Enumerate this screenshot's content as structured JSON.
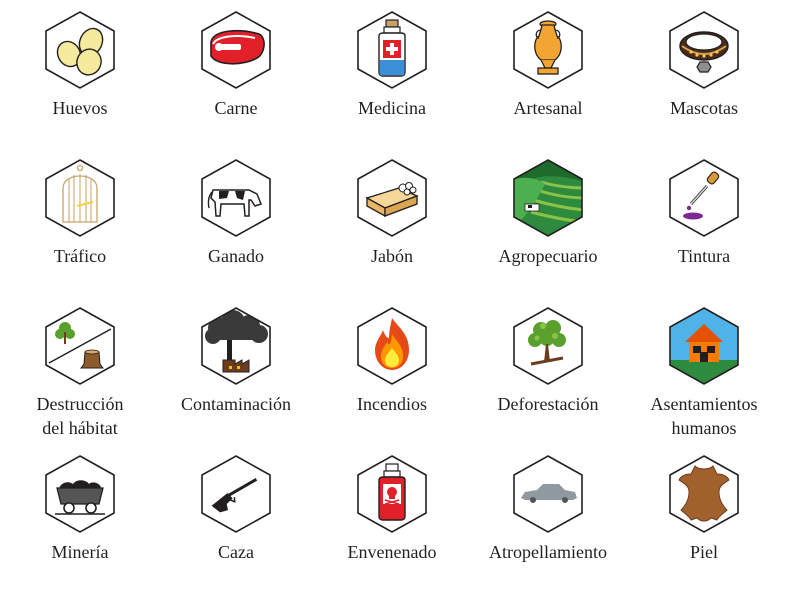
{
  "items": [
    {
      "label": "Huevos",
      "icon": "eggs-icon"
    },
    {
      "label": "Carne",
      "icon": "steak-icon"
    },
    {
      "label": "Medicina",
      "icon": "medicine-bottle-icon"
    },
    {
      "label": "Artesanal",
      "icon": "vase-icon"
    },
    {
      "label": "Mascotas",
      "icon": "collar-icon"
    },
    {
      "label": "Tráfico",
      "icon": "birdcage-icon"
    },
    {
      "label": "Ganado",
      "icon": "cow-icon"
    },
    {
      "label": "Jabón",
      "icon": "soap-icon"
    },
    {
      "label": "Agropecuario",
      "icon": "farmland-icon"
    },
    {
      "label": "Tintura",
      "icon": "dye-dropper-icon"
    },
    {
      "label": "Destrucción\ndel hábitat",
      "icon": "habitat-destruction-icon"
    },
    {
      "label": "Contaminación",
      "icon": "factory-smoke-icon"
    },
    {
      "label": "Incendios",
      "icon": "fire-icon"
    },
    {
      "label": "Deforestación",
      "icon": "deforestation-icon"
    },
    {
      "label": "Asentamientos\nhumanos",
      "icon": "house-icon"
    },
    {
      "label": "Minería",
      "icon": "mine-cart-icon"
    },
    {
      "label": "Caza",
      "icon": "rifle-icon"
    },
    {
      "label": "Envenenado",
      "icon": "poison-bottle-icon"
    },
    {
      "label": "Atropellamiento",
      "icon": "car-icon"
    },
    {
      "label": "Piel",
      "icon": "leather-hide-icon"
    }
  ]
}
